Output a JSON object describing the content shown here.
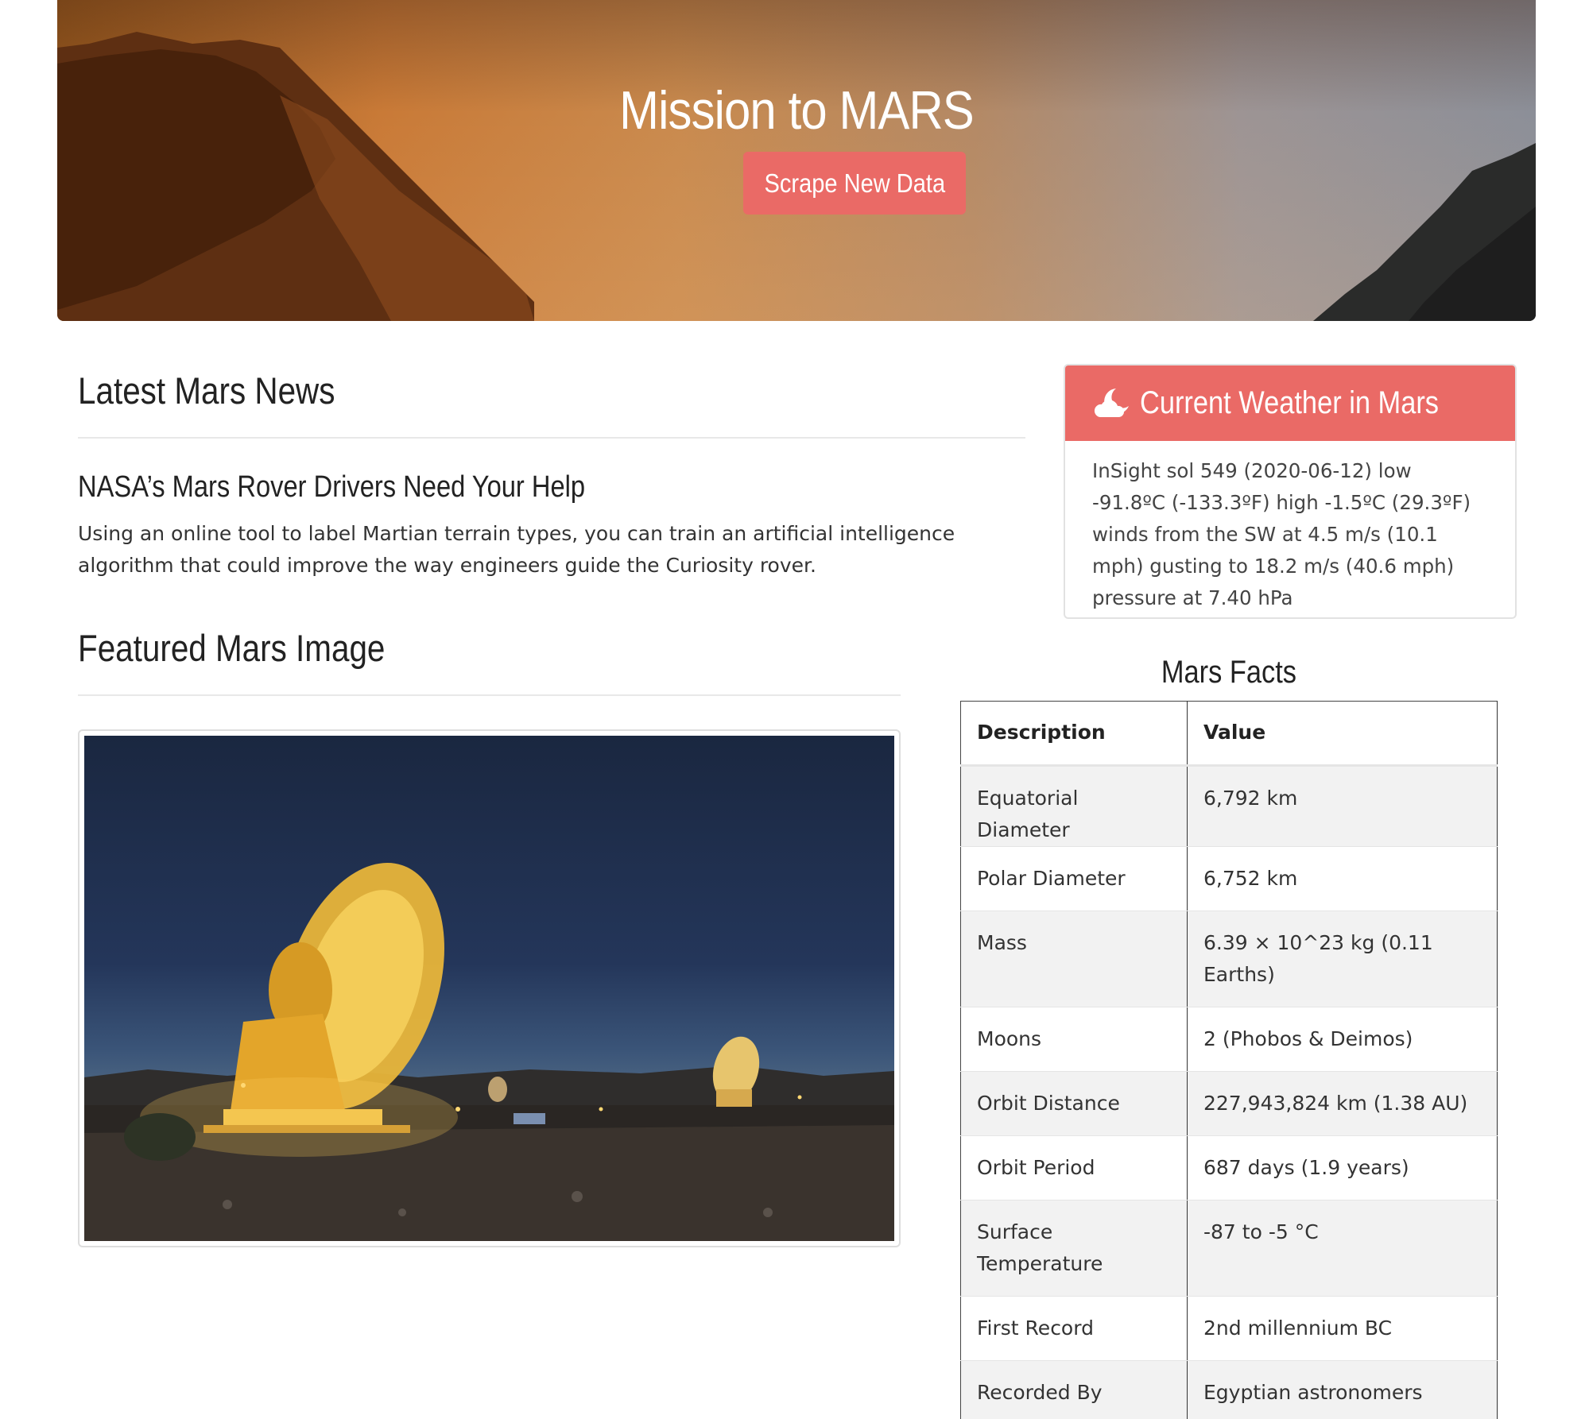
{
  "hero": {
    "title": "Mission to MARS",
    "button_label": "Scrape New Data"
  },
  "news": {
    "heading": "Latest Mars News",
    "title": "NASA’s Mars Rover Drivers Need Your Help",
    "paragraph": "Using an online tool to label Martian terrain types, you can train an artificial intelligence algorithm that could improve the way engineers guide the Curiosity rover."
  },
  "featured": {
    "heading": "Featured Mars Image"
  },
  "weather": {
    "icon": "cloud-moon-icon",
    "heading": "Current Weather in Mars",
    "text": "InSight sol 549 (2020-06-12) low -91.8ºC (-133.3ºF) high -1.5ºC (29.3ºF) winds from the SW at 4.5 m/s (10.1 mph) gusting to 18.2 m/s (40.6 mph) pressure at 7.40 hPa"
  },
  "facts": {
    "heading": "Mars Facts",
    "columns": [
      "Description",
      "Value"
    ],
    "rows": [
      [
        "Equatorial Diameter",
        "6,792 km"
      ],
      [
        "Polar Diameter",
        "6,752 km"
      ],
      [
        "Mass",
        "6.39 × 10^23 kg (0.11 Earths)"
      ],
      [
        "Moons",
        "2 (Phobos & Deimos)"
      ],
      [
        "Orbit Distance",
        "227,943,824 km (1.38 AU)"
      ],
      [
        "Orbit Period",
        "687 days (1.9 years)"
      ],
      [
        "Surface Temperature",
        "-87 to -5 °C"
      ],
      [
        "First Record",
        "2nd millennium BC"
      ],
      [
        "Recorded By",
        "Egyptian astronomers"
      ]
    ]
  },
  "colors": {
    "accent": "#ea6a66",
    "heading_text": "#222222",
    "body_text": "#333333"
  }
}
